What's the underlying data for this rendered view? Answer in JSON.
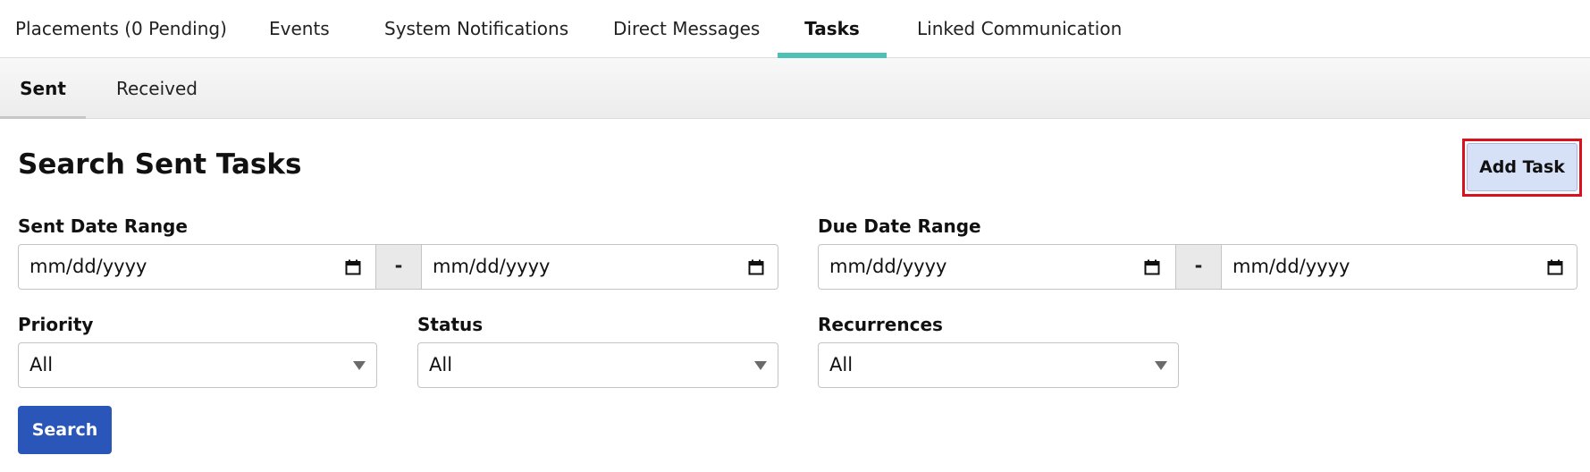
{
  "tabs": [
    {
      "label": "Placements (0 Pending)",
      "active": false
    },
    {
      "label": "Events",
      "active": false
    },
    {
      "label": "System Notifications",
      "active": false
    },
    {
      "label": "Direct Messages",
      "active": false
    },
    {
      "label": "Tasks",
      "active": true
    },
    {
      "label": "Linked Communication",
      "active": false
    }
  ],
  "subtabs": [
    {
      "label": "Sent",
      "active": true
    },
    {
      "label": "Received",
      "active": false
    }
  ],
  "page": {
    "title": "Search Sent Tasks",
    "add_button": "Add Task"
  },
  "filters": {
    "sent_date_range": {
      "label": "Sent Date Range",
      "from_placeholder": "mm/dd/yyyy",
      "to_placeholder": "mm/dd/yyyy",
      "separator": "-"
    },
    "due_date_range": {
      "label": "Due Date Range",
      "from_placeholder": "mm/dd/yyyy",
      "to_placeholder": "mm/dd/yyyy",
      "separator": "-"
    },
    "priority": {
      "label": "Priority",
      "value": "All"
    },
    "status": {
      "label": "Status",
      "value": "All"
    },
    "recurrences": {
      "label": "Recurrences",
      "value": "All"
    }
  },
  "search_button": "Search",
  "colors": {
    "active_tab_underline": "#4ec0b5",
    "primary_button": "#2a56b9",
    "add_button_bg": "#d6e0f6",
    "highlight_border": "#d9101e"
  },
  "icons": [
    "calendar-icon",
    "dropdown-caret-icon"
  ]
}
